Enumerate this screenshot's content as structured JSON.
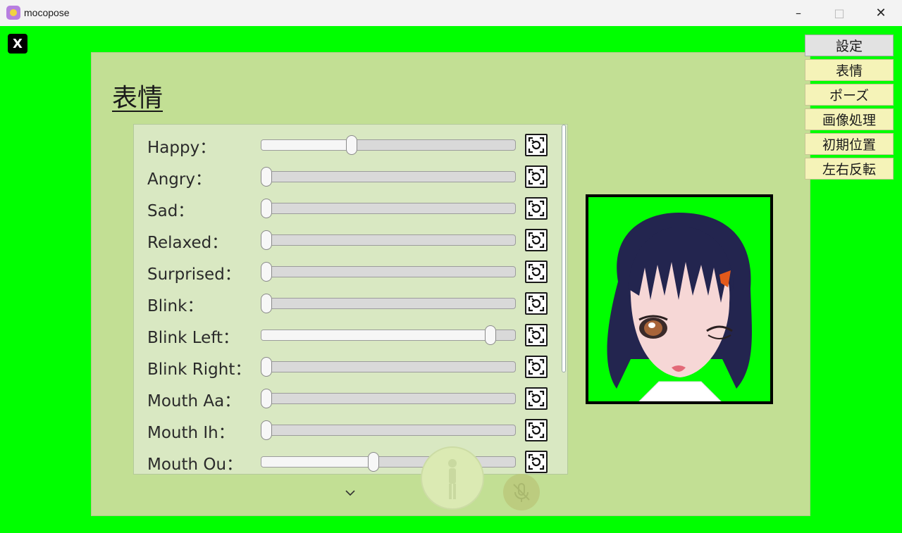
{
  "window": {
    "title": "mocopose"
  },
  "close_button": {
    "label": "X"
  },
  "panel": {
    "title": "表情"
  },
  "sliders": [
    {
      "label": "Happy：",
      "value": 0.35
    },
    {
      "label": "Angry：",
      "value": 0
    },
    {
      "label": "Sad：",
      "value": 0
    },
    {
      "label": "Relaxed：",
      "value": 0
    },
    {
      "label": "Surprised：",
      "value": 0
    },
    {
      "label": "Blink：",
      "value": 0
    },
    {
      "label": "Blink Left：",
      "value": 0.92
    },
    {
      "label": "Blink Right：",
      "value": 0
    },
    {
      "label": "Mouth Aa：",
      "value": 0
    },
    {
      "label": "Mouth Ih：",
      "value": 0
    },
    {
      "label": "Mouth Ou：",
      "value": 0.44
    }
  ],
  "side_menu": [
    {
      "label": "設定",
      "active": true
    },
    {
      "label": "表情",
      "active": false
    },
    {
      "label": "ポーズ",
      "active": false
    },
    {
      "label": "画像処理",
      "active": false
    },
    {
      "label": "初期位置",
      "active": false
    },
    {
      "label": "左右反転",
      "active": false
    }
  ],
  "colors": {
    "background": "#00ff00",
    "panel": "#c2df94",
    "menu": "#f5f3b8"
  },
  "icons": {
    "reset": "reset-rotate-icon",
    "scroll_down": "chevron-down-icon"
  }
}
